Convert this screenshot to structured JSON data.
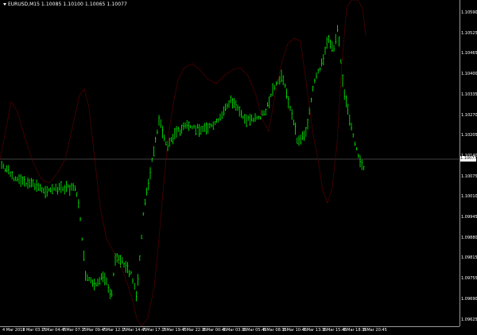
{
  "chart": {
    "symbol_info": "EURUSD,M15",
    "ohlc": "1.10085 1.10100 1.10065 1.10077",
    "symbol_icon": "chevron-down-icon",
    "current_price": "1.10077",
    "colors": {
      "background": "#000000",
      "bar": "#00ff00",
      "indicator": "#8b0000",
      "axis": "#9a9a9a",
      "text": "#ffffff"
    }
  },
  "price_axis": {
    "labels": [
      "1.10590",
      "1.10525",
      "1.10465",
      "1.10400",
      "1.10335",
      "1.10270",
      "1.10205",
      "1.10140",
      "1.10075",
      "1.10010",
      "1.09945",
      "1.09880",
      "1.09815",
      "1.09755",
      "1.09690",
      "1.09625"
    ]
  },
  "time_axis": {
    "labels": [
      "4 Mar 2016",
      "7 Mar 03:15",
      "7 Mar 04:45",
      "7 Mar 07:15",
      "7 Mar 09:45",
      "7 Mar 12:15",
      "7 Mar 14:45",
      "7 Mar 17:15",
      "7 Mar 19:45",
      "7 Mar 22:15",
      "8 Mar 00:45",
      "8 Mar 03:15",
      "8 Mar 05:45",
      "8 Mar 08:15",
      "8 Mar 10:45",
      "8 Mar 13:15",
      "8 Mar 15:45",
      "8 Mar 18:15",
      "8 Mar 20:45"
    ]
  }
}
